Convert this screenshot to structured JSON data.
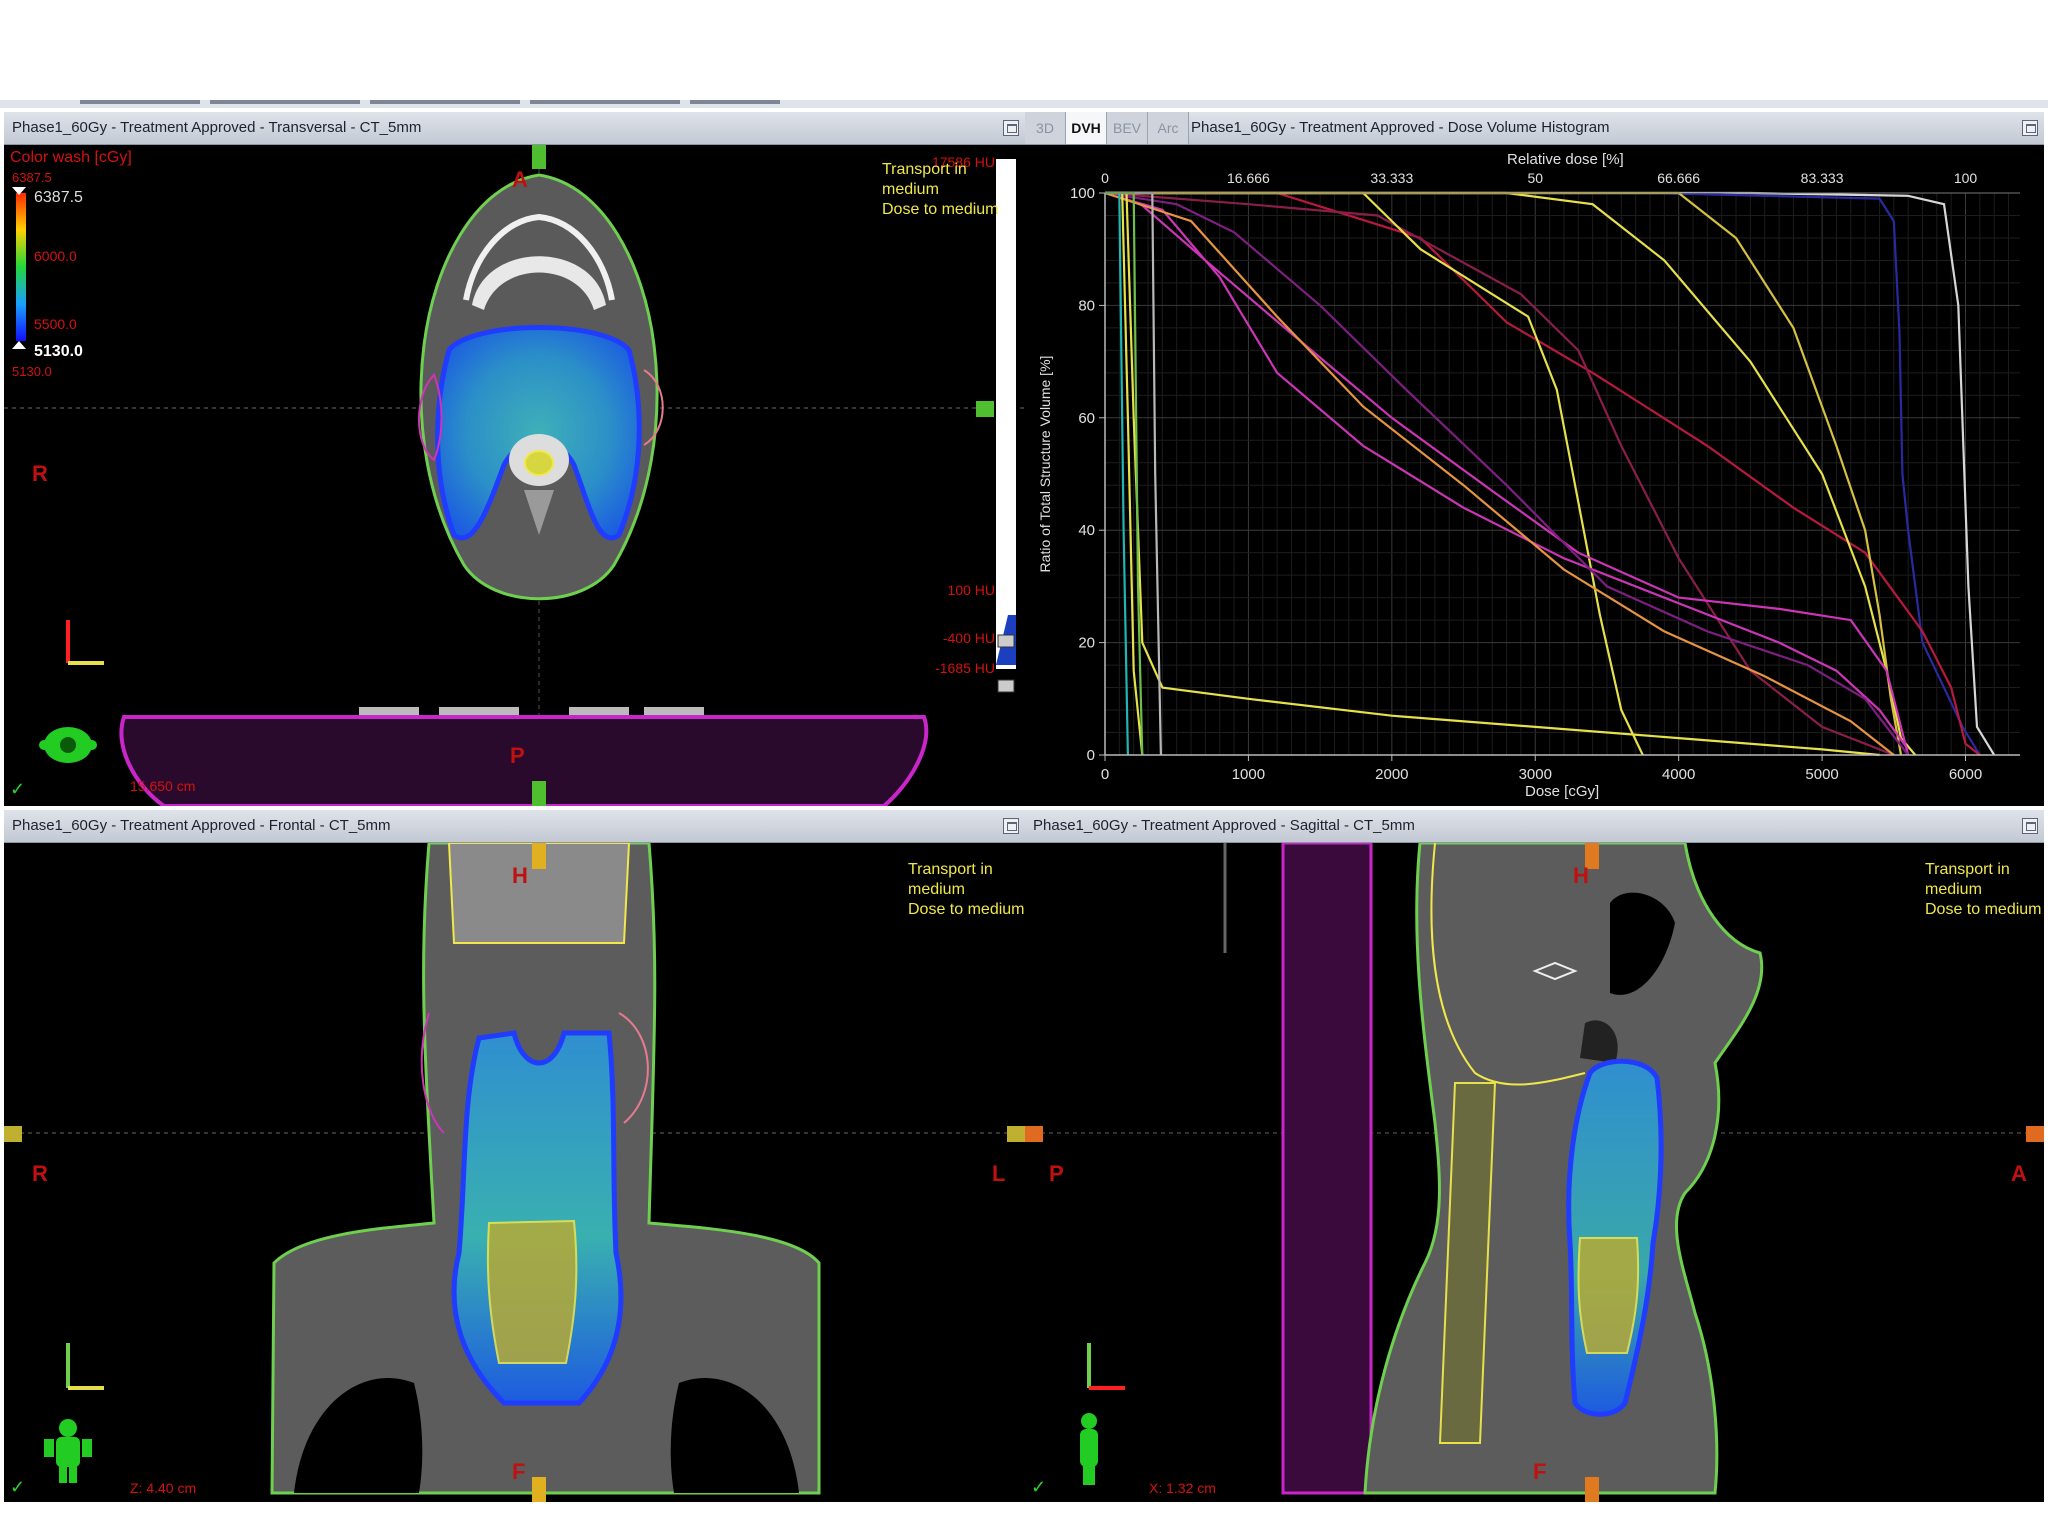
{
  "top_views": {
    "transversal_title": "Phase1_60Gy  -  Treatment Approved - Transversal - CT_5mm",
    "dvh_title": "Phase1_60Gy - Treatment Approved - Dose Volume Histogram",
    "dvh_tabs": [
      "3D",
      "DVH",
      "BEV",
      "Arc"
    ],
    "active_tab": "DVH"
  },
  "bottom_views": {
    "frontal_title": "Phase1_60Gy  -  Treatment Approved - Frontal - CT_5mm",
    "sagittal_title": "Phase1_60Gy  -  Treatment Approved - Sagittal - CT_5mm"
  },
  "transversal": {
    "colorwash_label": "Color wash [cGy]",
    "colorwash_max_top": "6387.5",
    "scale_top": "6387.5",
    "scale_6000": "6000.0",
    "scale_5500": "5500.0",
    "scale_bottom": "5130.0",
    "colorwash_min_bottom": "5130.0",
    "hu_top": "17586 HU",
    "hu_mid": "100 HU",
    "hu_low": "-400 HU",
    "hu_bottom": "-1685 HU",
    "transport": [
      "Transport in",
      "medium",
      "Dose to medium"
    ],
    "orient_top": "A",
    "orient_bottom": "P",
    "orient_left": "R",
    "couch_pos": "15.650 cm"
  },
  "frontal": {
    "transport": [
      "Transport in",
      "medium",
      "Dose to medium"
    ],
    "orient_top": "H",
    "orient_bottom": "F",
    "orient_left": "R",
    "orient_right": "L",
    "slice_pos": "Z: 4.40 cm"
  },
  "sagittal": {
    "transport": [
      "Transport in",
      "medium",
      "Dose to medium"
    ],
    "orient_top": "H",
    "orient_bottom": "F",
    "orient_left": "P",
    "orient_right": "A",
    "slice_pos": "X: 1.32 cm"
  },
  "check_mark": "✓",
  "colors": {
    "ptv": "#1f3cff",
    "body": "#6fcf4f",
    "titlebar": "#d3d8e0",
    "overlay_red": "#d41111",
    "overlay_yellow": "#f0e84a"
  },
  "chart_data": {
    "type": "line",
    "xlabel": "Dose [cGy]",
    "ylabel": "Ratio of Total Structure Volume [%]",
    "x2label": "Relative dose [%]",
    "xlim": [
      0,
      6380
    ],
    "ylim": [
      0,
      100
    ],
    "xticks": [
      0,
      1000,
      2000,
      3000,
      4000,
      5000,
      6000
    ],
    "yticks": [
      0,
      20,
      40,
      60,
      80,
      100
    ],
    "x2ticks": [
      "0",
      "16.666",
      "33.333",
      "50",
      "66.666",
      "83.333",
      "100"
    ],
    "grid": true,
    "series": [
      {
        "color": "#d6d6d6",
        "points": [
          [
            0,
            100
          ],
          [
            4500,
            100
          ],
          [
            5600,
            99.5
          ],
          [
            5850,
            98
          ],
          [
            5950,
            80
          ],
          [
            6020,
            30
          ],
          [
            6080,
            5
          ],
          [
            6200,
            0
          ]
        ]
      },
      {
        "color": "#2a2aa0",
        "points": [
          [
            0,
            100
          ],
          [
            3800,
            100
          ],
          [
            5400,
            99
          ],
          [
            5500,
            95
          ],
          [
            5540,
            75
          ],
          [
            5560,
            50
          ],
          [
            5600,
            40
          ],
          [
            5700,
            20
          ],
          [
            5850,
            12
          ],
          [
            5980,
            5
          ],
          [
            6100,
            0
          ]
        ]
      },
      {
        "color": "#b8193d",
        "points": [
          [
            0,
            100
          ],
          [
            1200,
            100
          ],
          [
            2200,
            92
          ],
          [
            2800,
            77
          ],
          [
            3400,
            68
          ],
          [
            4200,
            55
          ],
          [
            4800,
            44
          ],
          [
            5300,
            36
          ],
          [
            5700,
            22
          ],
          [
            5900,
            12
          ],
          [
            6000,
            2
          ],
          [
            6100,
            0
          ]
        ]
      },
      {
        "color": "#8a1e4a",
        "points": [
          [
            0,
            100
          ],
          [
            1000,
            98
          ],
          [
            1900,
            96
          ],
          [
            2900,
            82
          ],
          [
            3300,
            72
          ],
          [
            3600,
            55
          ],
          [
            4000,
            35
          ],
          [
            4500,
            15
          ],
          [
            5000,
            5
          ],
          [
            5500,
            0
          ]
        ]
      },
      {
        "color": "#e6e04a",
        "points": [
          [
            0,
            100
          ],
          [
            2800,
            100
          ],
          [
            3400,
            98
          ],
          [
            3900,
            88
          ],
          [
            4500,
            70
          ],
          [
            5000,
            50
          ],
          [
            5300,
            30
          ],
          [
            5450,
            15
          ],
          [
            5550,
            3
          ],
          [
            5650,
            0
          ]
        ]
      },
      {
        "color": "#e6e04a",
        "points": [
          [
            0,
            100
          ],
          [
            1800,
            100
          ],
          [
            2200,
            90
          ],
          [
            2700,
            82
          ],
          [
            2950,
            78
          ],
          [
            3150,
            65
          ],
          [
            3300,
            45
          ],
          [
            3450,
            25
          ],
          [
            3600,
            8
          ],
          [
            3750,
            0
          ]
        ]
      },
      {
        "color": "#d4c140",
        "points": [
          [
            0,
            100
          ],
          [
            3000,
            100
          ],
          [
            4000,
            100
          ],
          [
            4400,
            92
          ],
          [
            4800,
            76
          ],
          [
            5100,
            55
          ],
          [
            5300,
            40
          ],
          [
            5400,
            25
          ],
          [
            5480,
            10
          ],
          [
            5550,
            0
          ]
        ]
      },
      {
        "color": "#cc35b6",
        "points": [
          [
            0,
            100
          ],
          [
            400,
            97
          ],
          [
            800,
            85
          ],
          [
            1200,
            68
          ],
          [
            1800,
            55
          ],
          [
            2500,
            44
          ],
          [
            3200,
            35
          ],
          [
            4100,
            26
          ],
          [
            4700,
            20
          ],
          [
            5100,
            15
          ],
          [
            5400,
            8
          ],
          [
            5600,
            1
          ]
        ]
      },
      {
        "color": "#cc35b6",
        "points": [
          [
            0,
            100
          ],
          [
            250,
            98
          ],
          [
            700,
            88
          ],
          [
            1300,
            75
          ],
          [
            2000,
            60
          ],
          [
            2700,
            47
          ],
          [
            3300,
            36
          ],
          [
            4000,
            28
          ],
          [
            4700,
            26
          ],
          [
            5200,
            24
          ],
          [
            5450,
            15
          ],
          [
            5550,
            5
          ],
          [
            5600,
            0
          ]
        ]
      },
      {
        "color": "#7d1f80",
        "points": [
          [
            0,
            100
          ],
          [
            500,
            98
          ],
          [
            900,
            93
          ],
          [
            1500,
            80
          ],
          [
            2100,
            65
          ],
          [
            2800,
            48
          ],
          [
            3500,
            30
          ],
          [
            4200,
            22
          ],
          [
            4900,
            16
          ],
          [
            5300,
            10
          ],
          [
            5600,
            0
          ]
        ]
      },
      {
        "color": "#e79440",
        "points": [
          [
            0,
            100
          ],
          [
            600,
            95
          ],
          [
            1200,
            78
          ],
          [
            1800,
            62
          ],
          [
            2500,
            48
          ],
          [
            3200,
            33
          ],
          [
            3900,
            22
          ],
          [
            4600,
            14
          ],
          [
            5200,
            6
          ],
          [
            5500,
            0
          ]
        ]
      },
      {
        "color": "#e6e04a",
        "points": [
          [
            0,
            100
          ],
          [
            150,
            100
          ],
          [
            200,
            60
          ],
          [
            260,
            20
          ],
          [
            400,
            12
          ],
          [
            1000,
            10
          ],
          [
            2000,
            7
          ],
          [
            3000,
            5
          ],
          [
            4000,
            3
          ],
          [
            5000,
            1
          ],
          [
            5400,
            0
          ]
        ]
      },
      {
        "color": "#e6e04a",
        "points": [
          [
            0,
            100
          ],
          [
            120,
            100
          ],
          [
            160,
            60
          ],
          [
            200,
            15
          ],
          [
            260,
            0
          ]
        ]
      },
      {
        "color": "#21b5b5",
        "points": [
          [
            0,
            100
          ],
          [
            100,
            100
          ],
          [
            130,
            40
          ],
          [
            160,
            0
          ]
        ]
      },
      {
        "color": "#b7b7b7",
        "points": [
          [
            0,
            100
          ],
          [
            330,
            100
          ],
          [
            350,
            50
          ],
          [
            390,
            0
          ]
        ]
      },
      {
        "color": "#6cbf4a",
        "points": [
          [
            0,
            100
          ],
          [
            200,
            100
          ],
          [
            230,
            30
          ],
          [
            260,
            0
          ]
        ]
      }
    ]
  }
}
